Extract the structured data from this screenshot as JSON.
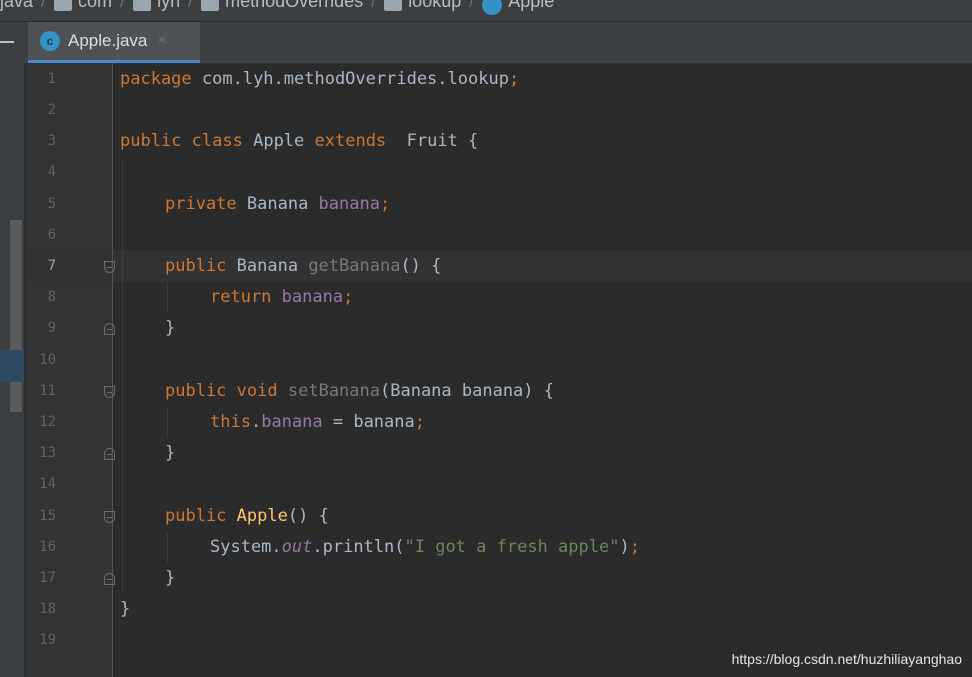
{
  "breadcrumbs": [
    "java",
    "com",
    "lyh",
    "methodOverrides",
    "lookup",
    "Apple"
  ],
  "tab": {
    "title": "Apple.java",
    "icon_letter": "c",
    "close": "×"
  },
  "line_numbers": [
    "1",
    "2",
    "3",
    "4",
    "5",
    "6",
    "7",
    "8",
    "9",
    "10",
    "11",
    "12",
    "13",
    "14",
    "15",
    "16",
    "17",
    "18",
    "19"
  ],
  "current_line": "7",
  "code": {
    "l1": {
      "kw": "package",
      "rest": " com.lyh.methodOverrides.lookup",
      "semi": ";"
    },
    "l3": {
      "kw1": "public",
      "kw2": "class",
      "name": " Apple ",
      "kw3": "extends",
      "rest": "  Fruit {"
    },
    "l5": {
      "kw": "private",
      "type": " Banana ",
      "field": "banana",
      "semi": ";"
    },
    "l7": {
      "kw": "public",
      "type": " Banana ",
      "method": "getBanana",
      "rest": "() {"
    },
    "l8": {
      "kw": "return",
      "field": "banana",
      "semi": ";"
    },
    "l9": {
      "text": "}"
    },
    "l11": {
      "kw1": "public",
      "kw2": "void",
      "method": "setBanana",
      "rest": "(Banana banana) {"
    },
    "l12": {
      "kw": "this",
      "dot": ".",
      "field": "banana",
      "rest": " = banana",
      "semi": ";"
    },
    "l13": {
      "text": "}"
    },
    "l15": {
      "kw": "public",
      "method": "Apple",
      "rest": "() {"
    },
    "l16": {
      "cls": "System.",
      "static_field": "out",
      "call": ".println(",
      "str": "\"I got a fresh apple\"",
      "close": ")",
      "semi": ";"
    },
    "l17": {
      "text": "}"
    },
    "l18": {
      "text": "}"
    }
  },
  "watermark": "https://blog.csdn.net/huzhiliayanghao",
  "colors": {
    "background": "#2b2b2b",
    "keyword": "#cc7832",
    "field": "#9876aa",
    "method": "#ffc66d",
    "string": "#6a8759",
    "accent": "#4a88c7"
  }
}
